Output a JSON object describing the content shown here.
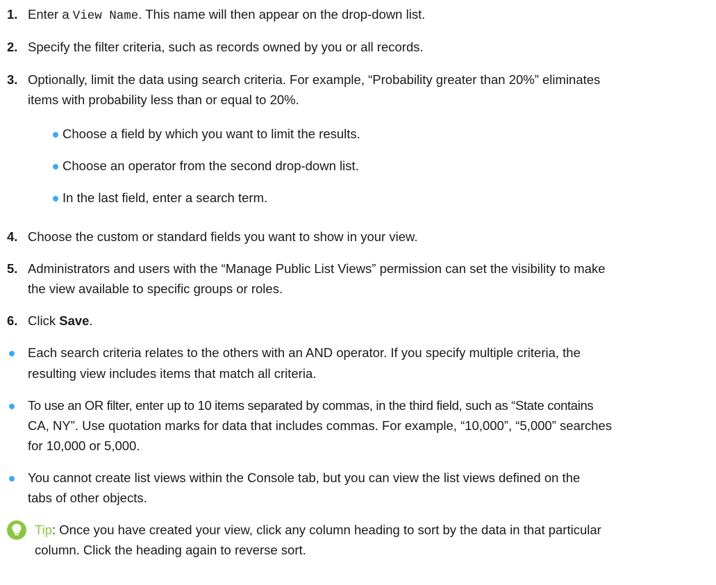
{
  "steps": [
    {
      "num": "1.",
      "lines": [
        {
          "a": "Enter a ",
          "mono": "View Name",
          "b": ". This name will then appear on the drop-down list."
        }
      ]
    },
    {
      "num": "2.",
      "lines": [
        "Specify the filter criteria, such as records owned by you or all records."
      ]
    },
    {
      "num": "3.",
      "lines": [
        "Optionally, limit the data using search criteria. For example, “Probability greater than 20%” eliminates",
        "items with probability less than or equal to 20%."
      ],
      "subitems": [
        "Choose a field by which you want to limit the results.",
        "Choose an operator from the second drop-down list.",
        "In the last field, enter a search term."
      ]
    },
    {
      "num": "4.",
      "lines": [
        "Choose the custom or standard fields you want to show in your view."
      ]
    },
    {
      "num": "5.",
      "lines": [
        "Administrators and users with the “Manage Public List Views” permission can set the visibility to make",
        "the view available to specific groups or roles."
      ]
    },
    {
      "num": "6.",
      "lines": [
        {
          "a": "Click ",
          "bold": "Save",
          "b": "."
        }
      ]
    }
  ],
  "notes": [
    [
      "Each search criteria relates to the others with an AND operator. If you specify multiple criteria, the",
      "resulting view includes items that match all criteria."
    ],
    [
      "To use an OR filter, enter up to 10 items separated by commas, in the third field, such as “State contains",
      "CA, NY”. Use quotation marks for data that includes commas. For example, “10,000”, “5,000” searches",
      "for 10,000 or 5,000."
    ],
    [
      "You cannot create list views within the Console tab, but you can view the list views defined on the",
      "tabs of other objects."
    ]
  ],
  "tip": {
    "label": "Tip",
    "lines": [
      ": Once you have created your view, click any column heading to sort by the data in that particular",
      "column. Click the heading again to reverse sort."
    ]
  },
  "colors": {
    "bullet": "#3fa9f5",
    "tip": "#8cc63f"
  },
  "icons": {
    "tip": "lightbulb-icon"
  }
}
